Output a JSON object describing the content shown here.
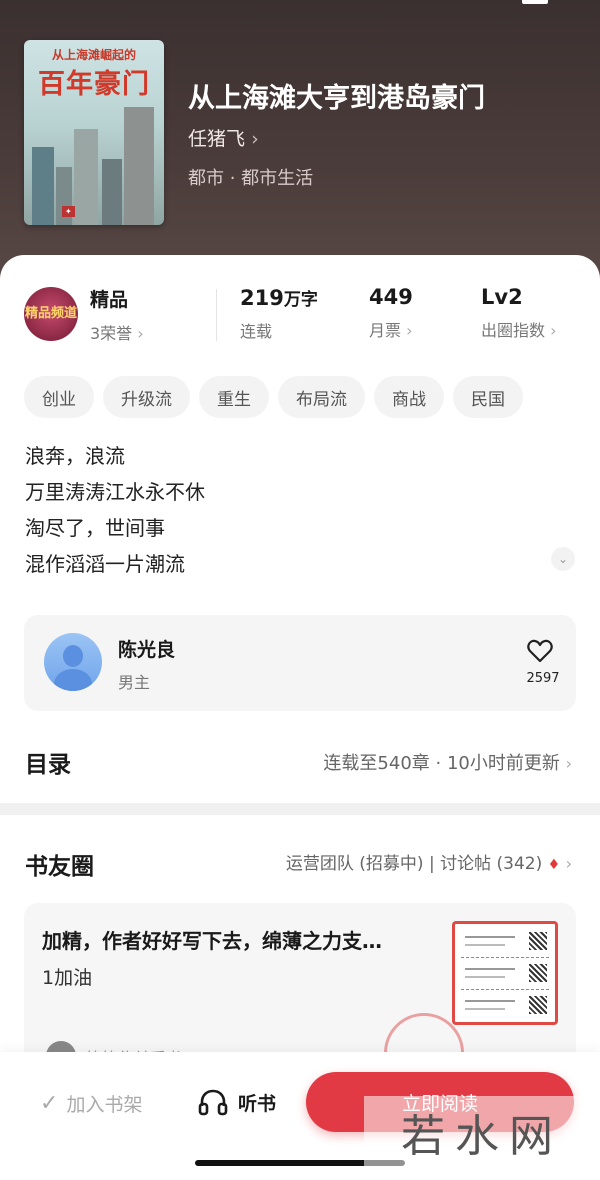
{
  "book": {
    "cover_top": "从上海滩崛起的",
    "cover_title": "百年豪门",
    "title": "从上海滩大亨到港岛豪门",
    "author": "任猪飞",
    "genre": "都市 · 都市生活"
  },
  "stats": {
    "badge_text": "精品频道",
    "quality_label": "精品",
    "honors": "3荣誉",
    "words_value": "219",
    "words_unit": "万字",
    "words_label": "连载",
    "tickets_value": "449",
    "tickets_label": "月票",
    "level_value": "Lv2",
    "level_label": "出圈指数"
  },
  "tags": [
    "创业",
    "升级流",
    "重生",
    "布局流",
    "商战",
    "民国"
  ],
  "description": [
    "浪奔，浪流",
    "万里涛涛江水永不休",
    "淘尽了，世间事",
    "混作滔滔一片潮流"
  ],
  "character": {
    "name": "陈光良",
    "role": "男主",
    "likes": "2597"
  },
  "toc": {
    "title": "目录",
    "info": "连载至540章 · 10小时前更新"
  },
  "circle": {
    "title": "书友圈",
    "info": "运营团队 (招募中) | 讨论帖 (342)",
    "post_title": "加精，作者好好写下去，绵薄之力支…",
    "post_sub": "1加油",
    "post_user": "筷筷伪关采书"
  },
  "bottom": {
    "shelf": "加入书架",
    "listen": "听书",
    "read": "立即阅读"
  },
  "watermark": "若水网"
}
